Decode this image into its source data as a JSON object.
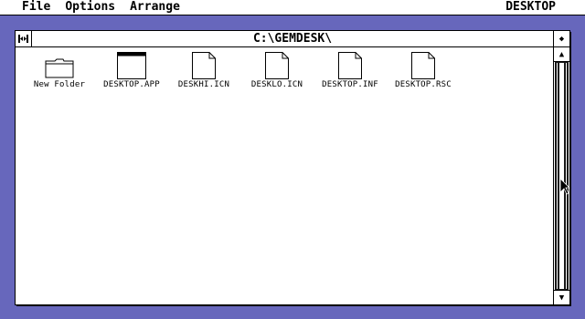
{
  "menubar": {
    "items": [
      {
        "label": "File"
      },
      {
        "label": "Options"
      },
      {
        "label": "Arrange"
      }
    ],
    "right_label": "DESKTOP"
  },
  "window": {
    "title": "C:\\GEMDESK\\",
    "close_glyph": "⇹",
    "full_glyph": "◆"
  },
  "icons": [
    {
      "label": "New Folder",
      "kind": "folder-icon"
    },
    {
      "label": "DESKTOP.APP",
      "kind": "application-icon"
    },
    {
      "label": "DESKHI.ICN",
      "kind": "document-icon"
    },
    {
      "label": "DESKLO.ICN",
      "kind": "document-icon"
    },
    {
      "label": "DESKTOP.INF",
      "kind": "document-icon"
    },
    {
      "label": "DESKTOP.RSC",
      "kind": "document-icon"
    }
  ],
  "scrollbar": {
    "up_glyph": "▲",
    "down_glyph": "▼"
  },
  "colors": {
    "desktop": "#5b5bb3",
    "window": "#ffffff",
    "ink": "#000000"
  }
}
